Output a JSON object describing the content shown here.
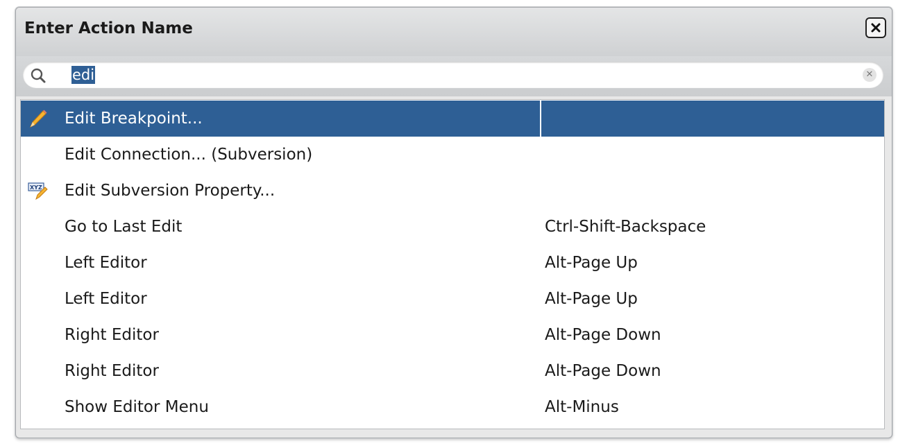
{
  "dialog": {
    "title": "Enter Action Name",
    "close_icon": "close-icon"
  },
  "search": {
    "value": "edi",
    "icon": "search-icon",
    "clear_icon": "clear-icon"
  },
  "actions": [
    {
      "label": "Edit Breakpoint...",
      "shortcut": "",
      "icon": "pencil-icon",
      "selected": true
    },
    {
      "label": "Edit Connection... (Subversion)",
      "shortcut": "",
      "icon": "",
      "selected": false
    },
    {
      "label": "Edit Subversion Property...",
      "shortcut": "",
      "icon": "edit-property-icon",
      "selected": false
    },
    {
      "label": "Go to Last Edit",
      "shortcut": "Ctrl-Shift-Backspace",
      "icon": "",
      "selected": false
    },
    {
      "label": "Left Editor",
      "shortcut": "Alt-Page Up",
      "icon": "",
      "selected": false
    },
    {
      "label": "Left Editor",
      "shortcut": "Alt-Page Up",
      "icon": "",
      "selected": false
    },
    {
      "label": "Right Editor",
      "shortcut": "Alt-Page Down",
      "icon": "",
      "selected": false
    },
    {
      "label": "Right Editor",
      "shortcut": "Alt-Page Down",
      "icon": "",
      "selected": false
    },
    {
      "label": "Show Editor Menu",
      "shortcut": "Alt-Minus",
      "icon": "",
      "selected": false
    }
  ],
  "colors": {
    "selection": "#2e5f95",
    "text_highlight": "#2f5f95"
  }
}
